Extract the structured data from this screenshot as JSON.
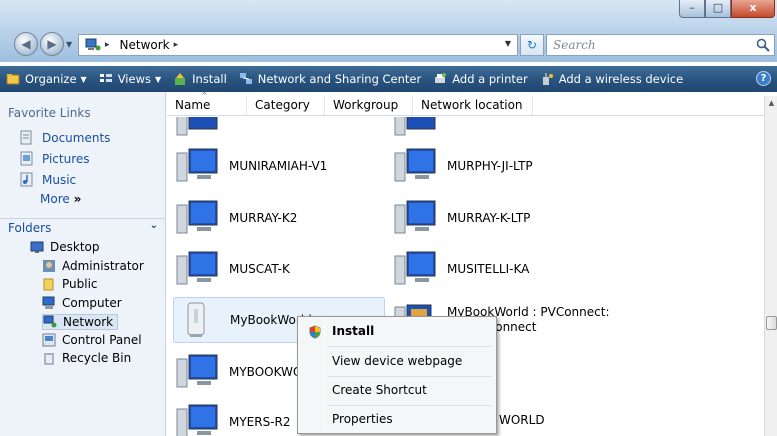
{
  "window": {
    "minimize": "–",
    "maximize": "□",
    "close": "x"
  },
  "nav": {
    "back": "◀",
    "forward": "▶"
  },
  "address": {
    "location": "Network",
    "separator": "▸"
  },
  "search": {
    "placeholder": "Search"
  },
  "toolbar": {
    "organize": "Organize",
    "views": "Views",
    "install": "Install",
    "network_sharing": "Network and Sharing Center",
    "add_printer": "Add a printer",
    "add_wireless": "Add a wireless device",
    "help": "?"
  },
  "sidebar": {
    "favorites_title": "Favorite Links",
    "favorites": [
      "Documents",
      "Pictures",
      "Music"
    ],
    "more": "More",
    "more_arrow": "»",
    "folders_title": "Folders",
    "tree": [
      "Desktop",
      "Administrator",
      "Public",
      "Computer",
      "Network",
      "Control Panel",
      "Recycle Bin"
    ],
    "selected": "Network"
  },
  "columns": [
    "Name",
    "Category",
    "Workgroup",
    "Network location"
  ],
  "items": {
    "left": [
      "MUNIRAMIAH-V1",
      "MURRAY-K2",
      "MUSCAT-K",
      "MyBookWorld",
      "MYBOOKWORLD",
      "MYERS-R2"
    ],
    "right": [
      "MURPHY-JI-LTP",
      "MURRAY-K-LTP",
      "MUSITELLI-KA",
      "MyBookWorld : PVConnect:",
      "Media Connect",
      "WORLD"
    ],
    "hovered": "MyBookWorld"
  },
  "context_menu": {
    "install": "Install",
    "view_webpage": "View device webpage",
    "create_shortcut": "Create Shortcut",
    "properties": "Properties"
  },
  "colors": {
    "toolbar": "#2a5580",
    "link": "#1a4ea0",
    "selection": "#e8f2fc"
  }
}
